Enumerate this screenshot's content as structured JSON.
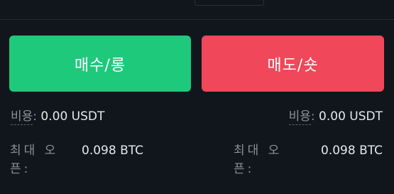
{
  "buttons": {
    "buy_label": "매수/롱",
    "sell_label": "매도/숏"
  },
  "buy_side": {
    "cost_label": "비용",
    "cost_value": "0.00 USDT",
    "max_open_label": "최대 오픈:",
    "max_open_value": "0.098 BTC"
  },
  "sell_side": {
    "cost_label": "비용",
    "cost_value": "0.00 USDT",
    "max_open_label": "최대 오픈:",
    "max_open_value": "0.098 BTC"
  },
  "colors": {
    "buy": "#1fc97c",
    "sell": "#f0475a",
    "background": "#11161d"
  }
}
